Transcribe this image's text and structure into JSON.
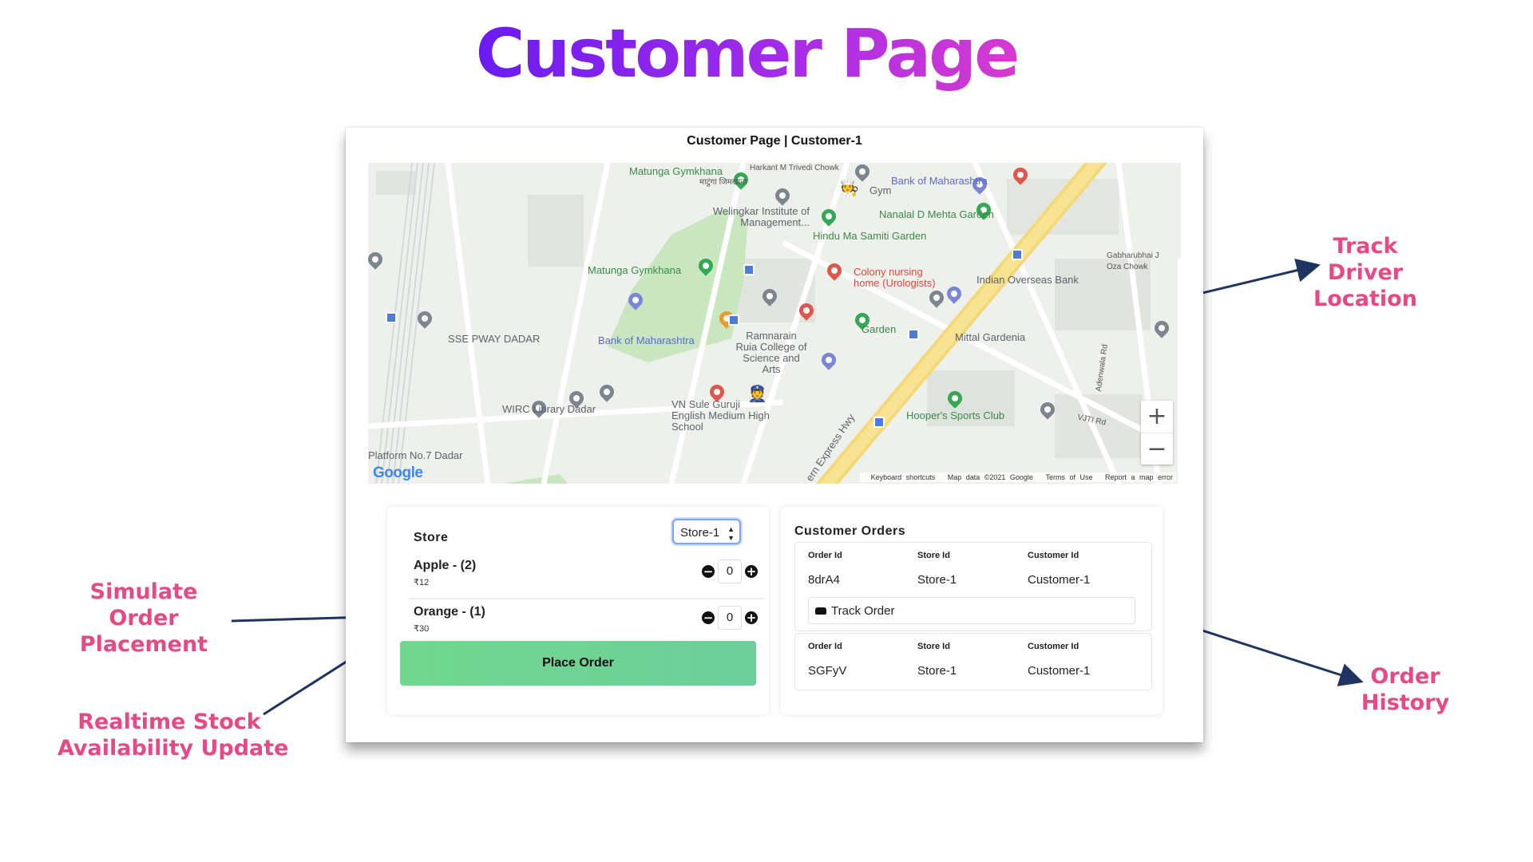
{
  "slide": {
    "title": "Customer Page",
    "annotations": {
      "track_driver": [
        "Track",
        "Driver",
        "Location"
      ],
      "simulate_order": [
        "Simulate",
        "Order",
        "Placement"
      ],
      "realtime_stock": [
        "Realtime Stock",
        "Availability Update"
      ],
      "order_history": [
        "Order",
        "History"
      ]
    }
  },
  "window": {
    "title": "Customer Page | Customer-1"
  },
  "map": {
    "labels": {
      "gymkhana_top": "Matunga Gymkhana",
      "gymkhana_top_local": "माटुंगा जिमखाना",
      "harkant": "Harkant M Trivedi Chowk",
      "gym": "Gym",
      "bank_maha_top": "Bank of Maharashtra",
      "welingkar": "Welingkar Institute of Management...",
      "nanalal": "Nanalal D Mehta Garden",
      "hindu_garden": "Hindu Ma Samiti Garden",
      "gabbar": "Gabharubhai J Oza Chowk",
      "gymkhana_mid": "Matunga Gymkhana",
      "colony": "Colony nursing home (Urologists)",
      "indian_overseas": "Indian Overseas Bank",
      "sse_pway": "SSE PWAY DADAR",
      "bank_maha_mid": "Bank of Maharashtra",
      "ramnarain": "Ramnarain Ruia College of Science and Arts",
      "garden": "Garden",
      "mittal": "Mittal Gardenia",
      "wirc": "WIRC Library Dadar",
      "vn_sule": "VN Sule Guruji English Medium High School",
      "hoopers": "Hooper's Sports Club",
      "platform": "Platform No.7 Dadar",
      "express": "ern Express Hwy",
      "vjti": "VJTI Rd",
      "adenwala": "Adenwala Rd"
    },
    "zoom_in": "+",
    "zoom_out": "−",
    "logo": "Google",
    "attribution": {
      "shortcuts": "Keyboard shortcuts",
      "map_data": "Map data ©2021 Google",
      "terms": "Terms of Use",
      "report": "Report a map error"
    }
  },
  "store": {
    "label": "Store",
    "selected": "Store-1",
    "products": [
      {
        "name": "Apple - (2)",
        "price": "₹12",
        "qty": "0"
      },
      {
        "name": "Orange - (1)",
        "price": "₹30",
        "qty": "0"
      }
    ],
    "place_order": "Place Order"
  },
  "orders": {
    "title": "Customer Orders",
    "headers": [
      "Order Id",
      "Store Id",
      "Customer Id"
    ],
    "rows": [
      {
        "order_id": "8drA4",
        "store_id": "Store-1",
        "customer_id": "Customer-1",
        "track_label": "Track Order"
      },
      {
        "order_id": "SGFyV",
        "store_id": "Store-1",
        "customer_id": "Customer-1"
      }
    ]
  },
  "colors": {
    "accent_purple": "#6a1bf2",
    "annotation_pink": "#e54a86",
    "arrow_navy": "#1f3561",
    "place_order_green": "#6fd88c"
  }
}
